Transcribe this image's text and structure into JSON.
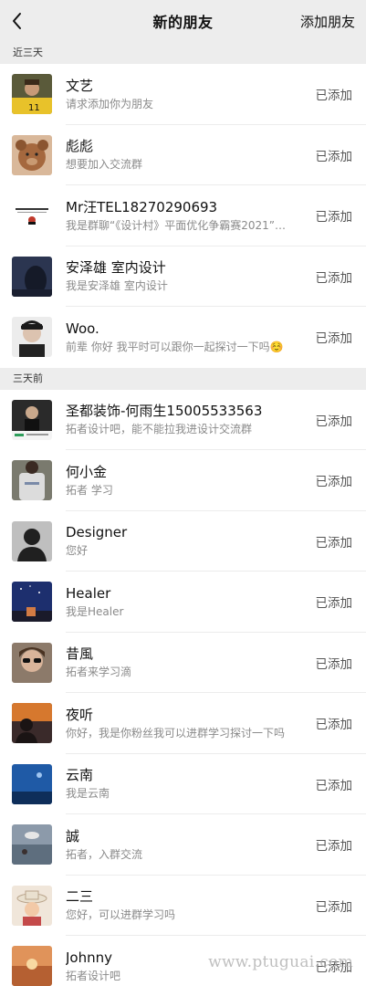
{
  "header": {
    "title": "新的朋友",
    "add_label": "添加朋友"
  },
  "sections": [
    {
      "label": "近三天",
      "items": [
        {
          "name": "文艺",
          "message": "请求添加你为朋友",
          "status": "已添加",
          "avatar": "soccer-player-avatar"
        },
        {
          "name": "彪彪",
          "message": "想要加入交流群",
          "status": "已添加",
          "avatar": "teddy-bear-avatar"
        },
        {
          "name": "Mr汪TEL18270290693",
          "message": "我是群聊“《设计村》平面优化争霸赛2021”…",
          "status": "已添加",
          "avatar": "design-logo-avatar"
        },
        {
          "name": "安泽雄  室内设计",
          "message": "我是安泽雄  室内设计",
          "status": "已添加",
          "avatar": "night-silhouette-avatar"
        },
        {
          "name": "Woo.",
          "message": "前辈 你好 我平时可以跟你一起探讨一下吗☺️",
          "status": "已添加",
          "avatar": "portrait-avatar"
        }
      ]
    },
    {
      "label": "三天前",
      "items": [
        {
          "name": "圣都装饰-何雨生15005533563",
          "message": "拓者设计吧，能不能拉我进设计交流群",
          "status": "已添加",
          "avatar": "business-card-avatar"
        },
        {
          "name": "何小金",
          "message": "拓者  学习",
          "status": "已添加",
          "avatar": "sweater-avatar"
        },
        {
          "name": "Designer",
          "message": "您好",
          "status": "已添加",
          "avatar": "shadow-silhouette-avatar"
        },
        {
          "name": "Healer",
          "message": "我是Healer",
          "status": "已添加",
          "avatar": "night-sky-avatar"
        },
        {
          "name": "昔風",
          "message": "拓者来学习滴",
          "status": "已添加",
          "avatar": "sunglasses-avatar"
        },
        {
          "name": "夜听",
          "message": "你好，我是你粉丝我可以进群学习探讨一下吗",
          "status": "已添加",
          "avatar": "sunset-silhouette-avatar"
        },
        {
          "name": "云南",
          "message": "我是云南",
          "status": "已添加",
          "avatar": "blue-sky-avatar"
        },
        {
          "name": "誠",
          "message": "拓者，入群交流",
          "status": "已添加",
          "avatar": "lake-view-avatar"
        },
        {
          "name": "二三",
          "message": "您好，可以进群学习吗",
          "status": "已添加",
          "avatar": "cartoon-hat-avatar"
        },
        {
          "name": "Johnny",
          "message": "拓者设计吧",
          "status": "已添加",
          "avatar": "sunset-avatar"
        }
      ]
    }
  ],
  "watermark": "www.ptuguai.com"
}
